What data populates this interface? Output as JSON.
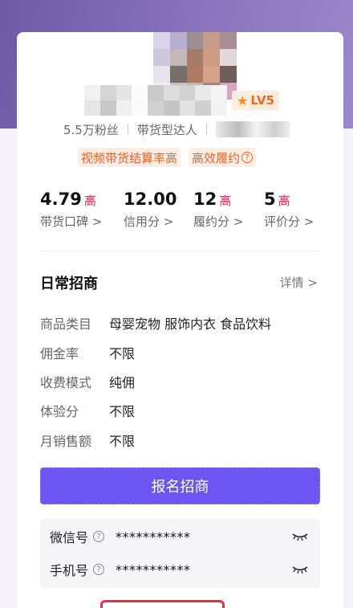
{
  "profile": {
    "level": "LV5",
    "fans": "5.5万粉丝",
    "type": "带货型达人",
    "tags": [
      "视频带货结算率高",
      "高效履约"
    ]
  },
  "stats": [
    {
      "value": "4.79",
      "level": "高",
      "label": "带货口碑 >"
    },
    {
      "value": "12.00",
      "level": "",
      "label": "信用分 >"
    },
    {
      "value": "12",
      "level": "高",
      "label": "履约分 >"
    },
    {
      "value": "5",
      "level": "高",
      "label": "评价分 >"
    }
  ],
  "section": {
    "title": "日常招商",
    "detail": "详情 >",
    "rows": [
      {
        "key": "商品类目",
        "value": "母婴宠物 服饰内衣 食品饮料"
      },
      {
        "key": "佣金率",
        "value": "不限"
      },
      {
        "key": "收费模式",
        "value": "纯佣"
      },
      {
        "key": "体验分",
        "value": "不限"
      },
      {
        "key": "月销售额",
        "value": "不限"
      }
    ]
  },
  "signup_label": "报名招商",
  "contacts": [
    {
      "key": "微信号",
      "value": "***********"
    },
    {
      "key": "手机号",
      "value": "***********"
    }
  ],
  "colors": {
    "accent": "#6d55f4",
    "high": "#e8324f",
    "tag": "#f0622a"
  },
  "icons": {
    "level": "star-icon",
    "hidden": "closed-eye-icon",
    "help": "question-icon"
  }
}
